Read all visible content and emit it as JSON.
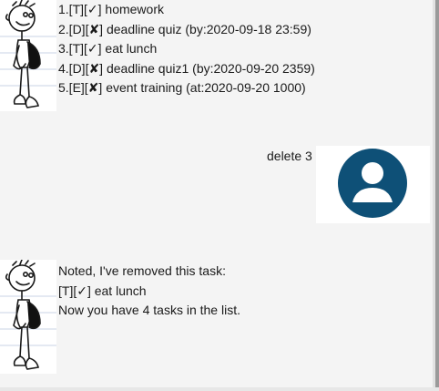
{
  "conversation": {
    "duke_reply_1": {
      "lines": [
        "1.[T][✓] homework",
        "2.[D][✘] deadline quiz  (by:2020-09-18 23:59)",
        "3.[T][✓] eat lunch",
        "4.[D][✘] deadline quiz1  (by:2020-09-20 2359)",
        "5.[E][✘] event training  (at:2020-09-20 1000)"
      ]
    },
    "user_message": {
      "text": "delete 3"
    },
    "duke_reply_2": {
      "lines": [
        "Noted, I've removed this task:",
        "[T][✓] eat lunch",
        "Now you have 4 tasks in the list."
      ]
    }
  },
  "icons": {
    "duke_avatar": "cartoon-boy-avatar-icon",
    "user_avatar": "user-profile-icon"
  },
  "colors": {
    "background": "#f4f4f4",
    "user_avatar_fill": "#0e5077"
  }
}
